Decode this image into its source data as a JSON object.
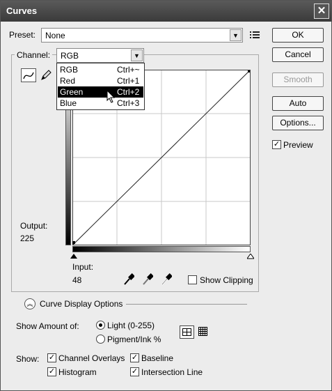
{
  "window": {
    "title": "Curves",
    "close_label": "✕"
  },
  "preset": {
    "label": "Preset:",
    "value": "None"
  },
  "channel": {
    "label": "Channel:",
    "value": "RGB",
    "options": [
      {
        "name": "RGB",
        "shortcut": "Ctrl+~"
      },
      {
        "name": "Red",
        "shortcut": "Ctrl+1"
      },
      {
        "name": "Green",
        "shortcut": "Ctrl+2"
      },
      {
        "name": "Blue",
        "shortcut": "Ctrl+3"
      }
    ],
    "highlighted": "Green"
  },
  "buttons": {
    "ok": "OK",
    "cancel": "Cancel",
    "smooth": "Smooth",
    "auto": "Auto",
    "options": "Options..."
  },
  "preview": {
    "label": "Preview",
    "checked": true
  },
  "output": {
    "label": "Output:",
    "value": "225"
  },
  "input": {
    "label": "Input:",
    "value": "48"
  },
  "show_clipping": {
    "label": "Show Clipping",
    "checked": false
  },
  "curve_display_options": {
    "label": "Curve Display Options"
  },
  "show_amount": {
    "label": "Show Amount of:",
    "light": "Light  (0-255)",
    "pigment": "Pigment/Ink %",
    "selected": "light"
  },
  "show": {
    "label": "Show:",
    "channel_overlays": "Channel Overlays",
    "baseline": "Baseline",
    "histogram": "Histogram",
    "intersection_line": "Intersection Line"
  },
  "icons": [
    "curve-tool-icon",
    "pencil-icon",
    "presets-menu-icon",
    "black-eyedropper-icon",
    "gray-eyedropper-icon",
    "white-eyedropper-icon",
    "collapse-icon",
    "simple-grid-icon",
    "detailed-grid-icon"
  ]
}
